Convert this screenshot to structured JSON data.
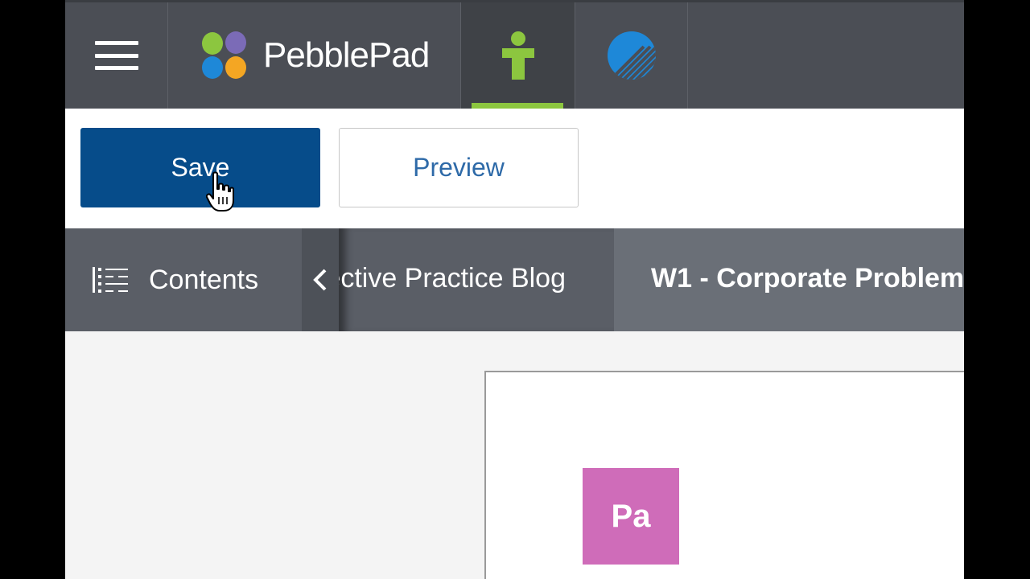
{
  "header": {
    "brand_name": "PebblePad",
    "icons": [
      "menu-icon",
      "pebblepad-logo-icon",
      "me-person-icon",
      "globe-icon"
    ],
    "active_tab_color": "#8cc63f"
  },
  "actions": {
    "save_label": "Save",
    "preview_label": "Preview"
  },
  "nav": {
    "contents_label": "Contents",
    "parent_crumb": "Reflective Practice Blog",
    "current_crumb": "W1 - Corporate Problem"
  },
  "content": {
    "tile_label": "Pa",
    "tile_color": "#cf6cb9"
  },
  "colors": {
    "topbar": "#4b4e55",
    "save_button": "#064c8a",
    "preview_text": "#2e6aa8",
    "navbar": "#5a5e66"
  }
}
